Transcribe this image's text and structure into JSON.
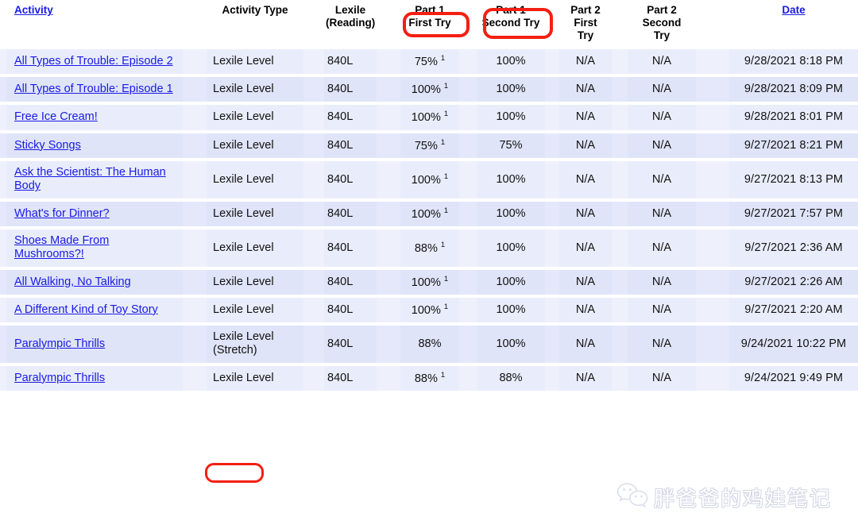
{
  "table": {
    "columns": [
      {
        "key": "activity",
        "label": "Activity",
        "link": true
      },
      {
        "key": "type",
        "label": "Activity Type",
        "link": false
      },
      {
        "key": "lexile",
        "label": "Lexile\n(Reading)",
        "line1": "Lexile",
        "line2": "(Reading)",
        "link": false
      },
      {
        "key": "p1first",
        "line1": "Part 1",
        "line2": "First Try",
        "link": false
      },
      {
        "key": "p1second",
        "line1": "Part 1",
        "line2": "Second Try",
        "link": false
      },
      {
        "key": "p2first",
        "line1": "Part 2",
        "line2": "First",
        "line3": "Try",
        "link": false
      },
      {
        "key": "p2second",
        "line1": "Part 2",
        "line2": "Second",
        "line3": "Try",
        "link": false
      },
      {
        "key": "date",
        "label": "Date",
        "link": true
      }
    ],
    "rows": [
      {
        "activity": "All Types of Trouble: Episode 2",
        "type": "Lexile Level",
        "type_note": "",
        "lexile": "840L",
        "p1first": "75%",
        "p1first_sup": "1",
        "p1second": "100%",
        "p2first": "N/A",
        "p2second": "N/A",
        "date": "9/28/2021  8:18 PM"
      },
      {
        "activity": "All Types of Trouble: Episode 1",
        "type": "Lexile Level",
        "type_note": "",
        "lexile": "840L",
        "p1first": "100%",
        "p1first_sup": "1",
        "p1second": "100%",
        "p2first": "N/A",
        "p2second": "N/A",
        "date": "9/28/2021  8:09 PM"
      },
      {
        "activity": "Free Ice Cream!",
        "type": "Lexile Level",
        "type_note": "",
        "lexile": "840L",
        "p1first": "100%",
        "p1first_sup": "1",
        "p1second": "100%",
        "p2first": "N/A",
        "p2second": "N/A",
        "date": "9/28/2021  8:01 PM"
      },
      {
        "activity": "Sticky Songs",
        "type": "Lexile Level",
        "type_note": "",
        "lexile": "840L",
        "p1first": "75%",
        "p1first_sup": "1",
        "p1second": "75%",
        "p2first": "N/A",
        "p2second": "N/A",
        "date": "9/27/2021  8:21 PM"
      },
      {
        "activity": "Ask the Scientist: The Human Body",
        "type": "Lexile Level",
        "type_note": "",
        "lexile": "840L",
        "p1first": "100%",
        "p1first_sup": "1",
        "p1second": "100%",
        "p2first": "N/A",
        "p2second": "N/A",
        "date": "9/27/2021  8:13 PM"
      },
      {
        "activity": "What's for Dinner?",
        "type": "Lexile Level",
        "type_note": "",
        "lexile": "840L",
        "p1first": "100%",
        "p1first_sup": "1",
        "p1second": "100%",
        "p2first": "N/A",
        "p2second": "N/A",
        "date": "9/27/2021  7:57 PM"
      },
      {
        "activity": "Shoes Made From Mushrooms?!",
        "type": "Lexile Level",
        "type_note": "",
        "lexile": "840L",
        "p1first": "88%",
        "p1first_sup": "1",
        "p1second": "100%",
        "p2first": "N/A",
        "p2second": "N/A",
        "date": "9/27/2021  2:36 AM"
      },
      {
        "activity": "All Walking, No Talking",
        "type": "Lexile Level",
        "type_note": "",
        "lexile": "840L",
        "p1first": "100%",
        "p1first_sup": "1",
        "p1second": "100%",
        "p2first": "N/A",
        "p2second": "N/A",
        "date": "9/27/2021  2:26 AM"
      },
      {
        "activity": "A Different Kind of Toy Story",
        "type": "Lexile Level",
        "type_note": "",
        "lexile": "840L",
        "p1first": "100%",
        "p1first_sup": "1",
        "p1second": "100%",
        "p2first": "N/A",
        "p2second": "N/A",
        "date": "9/27/2021  2:20 AM"
      },
      {
        "activity": "Paralympic Thrills",
        "type": "Lexile Level",
        "type_note": "(Stretch)",
        "lexile": "840L",
        "p1first": "88%",
        "p1first_sup": "",
        "p1second": "100%",
        "p2first": "N/A",
        "p2second": "N/A",
        "date": "9/24/2021 10:22 PM"
      },
      {
        "activity": "Paralympic Thrills",
        "type": "Lexile Level",
        "type_note": "",
        "lexile": "840L",
        "p1first": "88%",
        "p1first_sup": "1",
        "p1second": "88%",
        "p2first": "N/A",
        "p2second": "N/A",
        "date": "9/24/2021  9:49 PM"
      }
    ]
  },
  "annotations": {
    "color": "#f41f12",
    "boxes": [
      {
        "name": "first-try-highlight",
        "target": "Part 1 First Try"
      },
      {
        "name": "second-try-highlight",
        "target": "Part 1 Second Try"
      },
      {
        "name": "stretch-highlight",
        "target": "(Stretch)"
      }
    ]
  },
  "watermark": {
    "icon": "wechat-icon",
    "text": "胖爸爸的鸡娃笔记"
  },
  "colors": {
    "link": "#1a1ae6",
    "row_light": "#e9edfb",
    "row_dark": "#dfe4f8",
    "annotation_red": "#f41f12"
  }
}
